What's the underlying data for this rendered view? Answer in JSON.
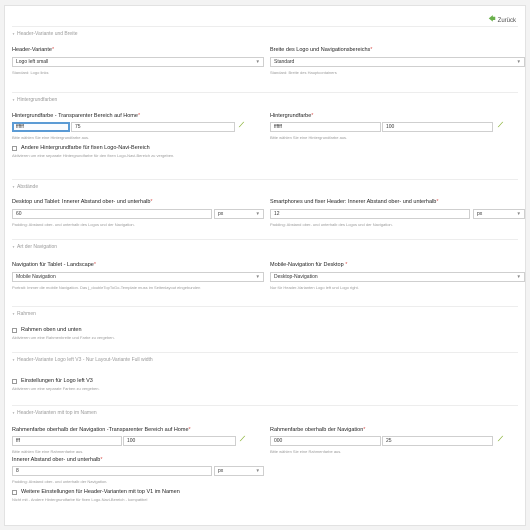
{
  "back": {
    "label": "Zurück"
  },
  "sections": {
    "s1": "Header-Variante und Breite",
    "s2": "Hintergrundfarben",
    "s3": "Abstände",
    "s4": "Art der Navigation",
    "s5": "Rahmen",
    "s6": "Header-Variante Logo left V3 - Nur Layout-Variante Full width",
    "s7": "Header-Varianten mit top im Namen"
  },
  "f": {
    "header_variant": {
      "label": "Header-Variante",
      "value": "Logo left small",
      "hint": "Standard: Logo links"
    },
    "width": {
      "label": "Breite des Logo und Navigationsbereichs",
      "value": "Standard",
      "hint": "Standard: Breite des Hauptcontainers"
    },
    "bg_trans": {
      "label": "Hintergrundfarbe - Transparenter Bereich auf Home",
      "color": "ffffff",
      "opacity": "75",
      "hint": "Bitte wählen Sie eine Hintergrundfarbe aus."
    },
    "bg": {
      "label": "Hintergrundfarbe",
      "color": "ffffff",
      "opacity": "100",
      "hint": "Bitte wählen Sie eine Hintergrundfarbe aus."
    },
    "alt_bg": {
      "label": "Andere Hintergrundfarbe für fixen Logo-Navi-Bereich",
      "hint": "Aktivieren um eine separate Hintergrundfarbe für den fixen Logo-Navi-Bereich zu vergeben."
    },
    "pad_desktop": {
      "label": "Desktop und Tablet: Innerer Abstand ober- und unterhalb",
      "value": "60",
      "unit": "px",
      "hint": "Padding: Abstand ober- und unterhalb des Logos und der Navigation."
    },
    "pad_mobile": {
      "label": "Smartphones und fixer Header: Innerer Abstand ober- und unterhalb",
      "value": "12",
      "unit": "px",
      "hint": "Padding: Abstand ober- und unterhalb des Logos und der Navigation."
    },
    "nav_tablet": {
      "label": "Navigation für Tablet - Landscape",
      "value": "Mobile Navigation",
      "hint": "Portrait: Immer die mobile Navigation. Das j_doubleTopToGo-Template muss im Seitenlayout eingebunden"
    },
    "nav_desktop": {
      "label": "Mobile-Navigation für Desktop",
      "value": "Desktop-Navigation",
      "hint": "Nur für Header-Varianten Logo left und Logo right."
    },
    "frame": {
      "label": "Rahmen oben und unten",
      "hint": "Aktivieren um eine Rahmenbreite und Farbe zu vergeben."
    },
    "v3": {
      "label": "Einstellungen für Logo left V3",
      "hint": "Aktivieren um eine separate Farben zu vergeben."
    },
    "frame_top_trans": {
      "label": "Rahmenfarbe oberhalb der Navigation -Transparenter Bereich auf Home",
      "color": "fff",
      "opacity": "100",
      "hint": "Bitte wählen Sie eine Rahmenfarbe aus."
    },
    "frame_top": {
      "label": "Rahmenfarbe oberhalb der Navigation",
      "color": "000",
      "opacity": "25",
      "hint": "Bitte wählen Sie eine Rahmenfarbe aus."
    },
    "pad_inner": {
      "label": "Innerer Abstand ober- und unterhalb",
      "value": "8",
      "unit": "px",
      "hint": "Padding: Abstand ober- und unterhalb der Navigation."
    },
    "more": {
      "label": "Weitere Einstellungen für Header-Varianten mit top V1 im Namen",
      "hint": "Nicht mit - Andere Hintergrundfarbe für fixen Logo-Navi-Bereich - kompatibel"
    }
  },
  "colors": {
    "accent": "#8ab338",
    "focus": "#5b9bd5",
    "required": "#d9534f"
  },
  "icons": {
    "back": "arrow-left-icon",
    "picker": "color-picker-icon",
    "chevron": "chevron-down-icon"
  }
}
